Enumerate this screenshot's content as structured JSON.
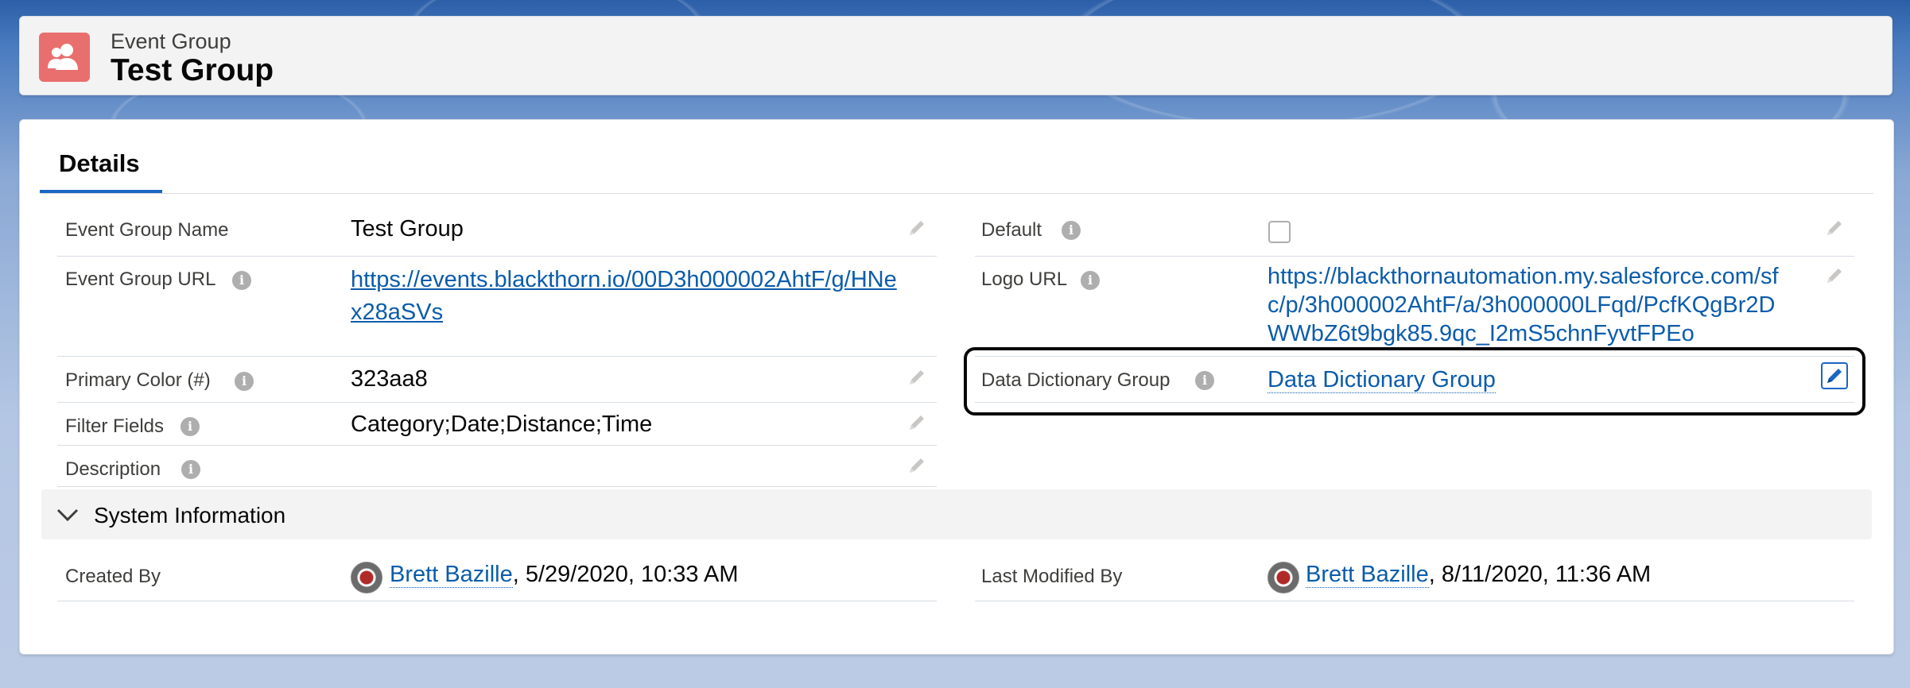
{
  "header": {
    "eyebrow": "Event Group",
    "title": "Test Group",
    "icon": "people-icon",
    "icon_color": "#e96f6f"
  },
  "tabs": [
    {
      "label": "Details",
      "active": true
    }
  ],
  "accent_color": "#1b65c4",
  "fields": {
    "event_group_name": {
      "label": "Event Group Name",
      "value": "Test Group"
    },
    "event_group_url": {
      "label": "Event Group URL",
      "value_line1": "https://events.blackthorn.io/00D3h000002AhtF/g/HNe",
      "value_line2": "x28aSVs"
    },
    "primary_color": {
      "label": "Primary Color (#)",
      "value": "323aa8"
    },
    "filter_fields": {
      "label": "Filter Fields",
      "value": "Category;Date;Distance;Time"
    },
    "description": {
      "label": "Description",
      "value": ""
    },
    "default": {
      "label": "Default",
      "checked": false
    },
    "logo_url": {
      "label": "Logo URL",
      "value_line1": "https://blackthornautomation.my.salesforce.com/sf",
      "value_line2": "c/p/3h000002AhtF/a/3h000000LFqd/PcfKQgBr2D",
      "value_line3": "WWbZ6t9bgk85.9qc_I2mS5chnFyvtFPEo"
    },
    "data_dictionary_group": {
      "label": "Data Dictionary Group",
      "value": "Data Dictionary Group"
    }
  },
  "system_information": {
    "title": "System Information",
    "expanded": true,
    "created_by": {
      "label": "Created By",
      "user": "Brett Bazille",
      "timestamp": ", 5/29/2020, 10:33 AM"
    },
    "last_modified_by": {
      "label": "Last Modified By",
      "user": "Brett Bazille",
      "timestamp": ", 8/11/2020, 11:36 AM"
    }
  }
}
